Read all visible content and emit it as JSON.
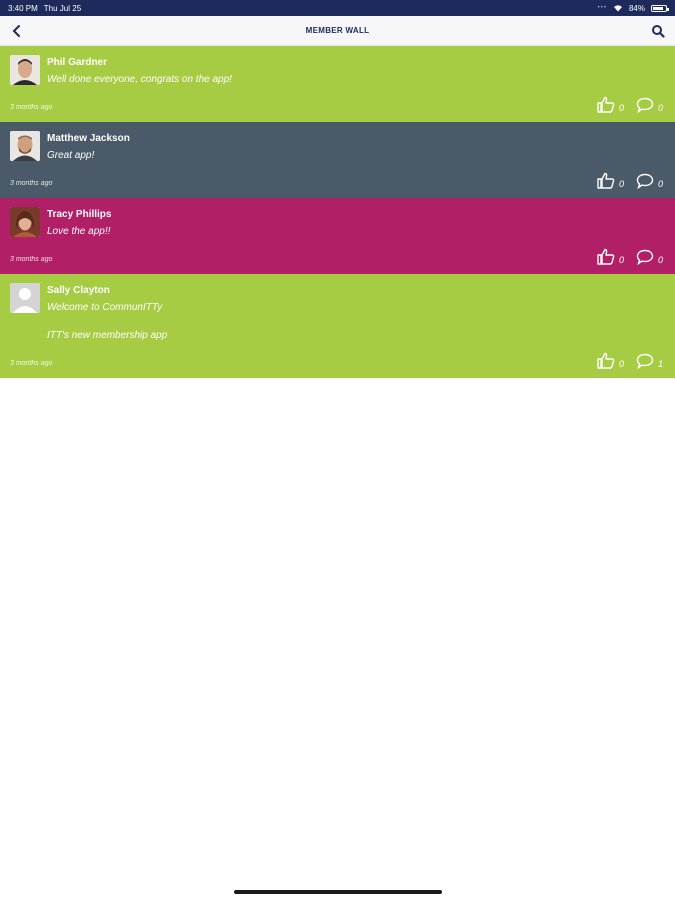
{
  "status_bar": {
    "time": "3:40 PM",
    "date": "Thu Jul 25",
    "battery_percent": "84%",
    "battery_level": 0.84
  },
  "nav": {
    "title": "MEMBER WALL",
    "back_icon": "chevron-left-icon",
    "search_icon": "search-icon"
  },
  "posts": [
    {
      "author": "Phil Gardner",
      "message": "Well done everyone, congrats on the app!",
      "message2": "",
      "time": "3 months ago",
      "likes": "0",
      "comments": "0",
      "color": "#a6cc44"
    },
    {
      "author": "Matthew Jackson",
      "message": "Great app!",
      "message2": "",
      "time": "3 months ago",
      "likes": "0",
      "comments": "0",
      "color": "#4a5a68"
    },
    {
      "author": "Tracy Phillips",
      "message": "Love the app!!",
      "message2": "",
      "time": "3 months ago",
      "likes": "0",
      "comments": "0",
      "color": "#b11f66"
    },
    {
      "author": "Sally Clayton",
      "message": "Welcome to CommunITTy",
      "message2": "ITT's new membership app",
      "time": "3 months ago",
      "likes": "0",
      "comments": "1",
      "color": "#a6cc44"
    }
  ]
}
